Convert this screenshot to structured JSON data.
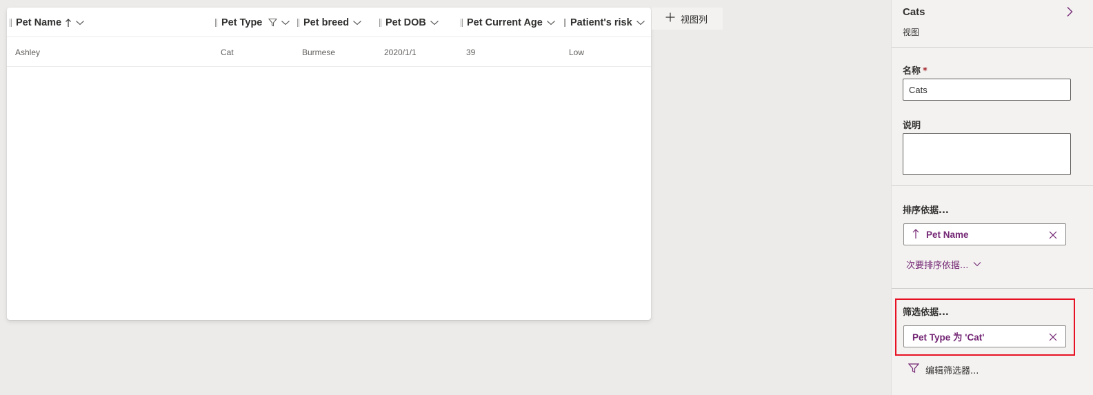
{
  "grid": {
    "columns": [
      {
        "label": "Pet Name",
        "sort": "ascending"
      },
      {
        "label": "Pet Type",
        "filtered": true
      },
      {
        "label": "Pet breed"
      },
      {
        "label": "Pet DOB"
      },
      {
        "label": "Pet Current Age"
      },
      {
        "label": "Patient's risk"
      }
    ],
    "rows": [
      {
        "pet_name": "Ashley",
        "pet_type": "Cat",
        "pet_breed": "Burmese",
        "pet_dob": "2020/1/1",
        "pet_current_age": "39",
        "patients_risk": "Low"
      }
    ]
  },
  "add_column": {
    "label": "视图列"
  },
  "panel": {
    "title": "Cats",
    "subtitle": "视图",
    "name_label": "名称",
    "required_mark": "*",
    "name_value": "Cats",
    "description_label": "说明",
    "description_value": "",
    "sort_label": "排序依据...",
    "sort_chip": "Pet Name",
    "secondary_sort": "次要排序依据...",
    "filter_label": "筛选依据...",
    "filter_chip": "Pet Type 为 'Cat'",
    "edit_filter": "编辑筛选器..."
  },
  "colors": {
    "accent": "#742774",
    "highlight": "#e81123",
    "required": "#a4262c"
  }
}
